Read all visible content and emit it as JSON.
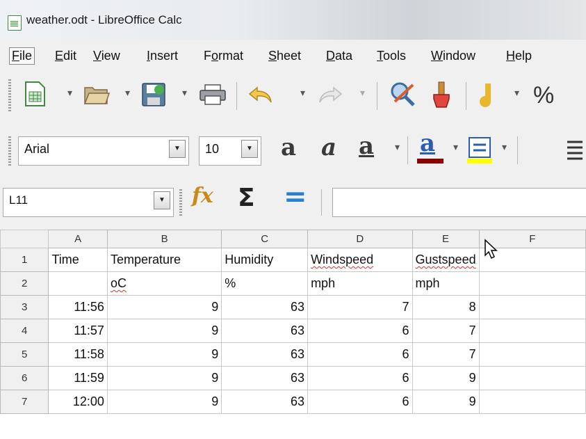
{
  "window": {
    "title": "weather.odt - LibreOffice Calc"
  },
  "menubar": {
    "items": [
      {
        "label": "File",
        "accel": "F",
        "rest": "ile"
      },
      {
        "label": "Edit",
        "accel": "E",
        "rest": "dit"
      },
      {
        "label": "View",
        "accel": "V",
        "rest": "iew"
      },
      {
        "label": "Insert",
        "accel": "I",
        "rest": "nsert"
      },
      {
        "label": "Format",
        "pre": "F",
        "accel": "o",
        "rest": "rmat"
      },
      {
        "label": "Sheet",
        "accel": "S",
        "rest": "heet"
      },
      {
        "label": "Data",
        "accel": "D",
        "rest": "ata"
      },
      {
        "label": "Tools",
        "accel": "T",
        "rest": "ools"
      },
      {
        "label": "Window",
        "accel": "W",
        "rest": "indow"
      },
      {
        "label": "Help",
        "accel": "H",
        "rest": "elp"
      }
    ]
  },
  "toolbar": {
    "percent_label": "%"
  },
  "format_toolbar": {
    "font_name": "Arial",
    "font_size": "10"
  },
  "formula_bar": {
    "cell_reference": "L11",
    "formula_value": ""
  },
  "sheet": {
    "columns": [
      "A",
      "B",
      "C",
      "D",
      "E",
      "F"
    ],
    "rows": [
      {
        "num": "1",
        "a": "Time",
        "b": "Temperature",
        "c": "Humidity",
        "d": "Windspeed",
        "e": "Gustspeed"
      },
      {
        "num": "2",
        "a": "",
        "b": "oC",
        "c": "%",
        "d": "mph",
        "e": "mph"
      },
      {
        "num": "3",
        "a": "11:56",
        "b": "9",
        "c": "63",
        "d": "7",
        "e": "8"
      },
      {
        "num": "4",
        "a": "11:57",
        "b": "9",
        "c": "63",
        "d": "6",
        "e": "7"
      },
      {
        "num": "5",
        "a": "11:58",
        "b": "9",
        "c": "63",
        "d": "6",
        "e": "7"
      },
      {
        "num": "6",
        "a": "11:59",
        "b": "9",
        "c": "63",
        "d": "6",
        "e": "9"
      },
      {
        "num": "7",
        "a": "12:00",
        "b": "9",
        "c": "63",
        "d": "6",
        "e": "9"
      }
    ]
  },
  "colors": {
    "accent_green": "#3f8a3f",
    "font_color_bar": "#8b0000",
    "highlight_bar": "#ffff00"
  }
}
